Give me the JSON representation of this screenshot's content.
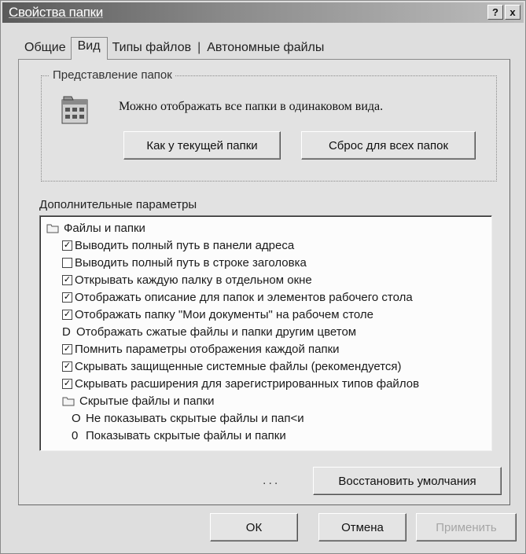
{
  "window": {
    "title": "Свойства папки",
    "help_btn": "?",
    "close_btn": "x"
  },
  "tabs": [
    {
      "label": "Общие",
      "active": false
    },
    {
      "label": "Вид",
      "active": true
    },
    {
      "label": "Типы файлов",
      "active": false
    },
    {
      "label": "Автономные файлы",
      "active": false
    }
  ],
  "view_group": {
    "legend": "Представление папок",
    "description": "Можно отображать все папки в одинаковом вида.",
    "like_current_btn": "Как у текущей папки",
    "reset_all_btn": "Сброс для всех папок"
  },
  "advanced": {
    "label": "Дополнительные параметры",
    "items": [
      {
        "kind": "folder",
        "text": "Файлы и папки",
        "level": 0
      },
      {
        "kind": "checkbox",
        "checked": true,
        "text": "Выводить полный путь в панели адреса",
        "level": 1
      },
      {
        "kind": "checkbox",
        "checked": false,
        "text": "Выводить полный путь в строке заголовка",
        "level": 1
      },
      {
        "kind": "checkbox",
        "checked": true,
        "text": "Открывать каждую палку в отдельном окне",
        "level": 1
      },
      {
        "kind": "checkbox",
        "checked": true,
        "text": "Отображать описание для папок и элементов рабочего стола",
        "level": 1
      },
      {
        "kind": "checkbox",
        "checked": true,
        "text": "Отображать папку \"Мои документы\" на рабочем столе",
        "level": 1
      },
      {
        "kind": "mark",
        "mark": "D",
        "text": "Отображать сжатые файлы и папки другим цветом",
        "level": 1
      },
      {
        "kind": "checkbox",
        "checked": true,
        "text": "Помнить параметры отображения каждой папки",
        "level": 1
      },
      {
        "kind": "checkbox",
        "checked": true,
        "text": "Скрывать защищенные системные файлы (рекомендуется)",
        "level": 1
      },
      {
        "kind": "checkbox",
        "checked": true,
        "text": "Скрывать расширения для зарегистрированных типов файлов",
        "level": 1
      },
      {
        "kind": "folder",
        "text": "Скрытые файлы и папки",
        "level": 1
      },
      {
        "kind": "mark",
        "mark": "O",
        "text": "Не показывать скрытые файлы и пап<и",
        "level": 2
      },
      {
        "kind": "mark",
        "mark": "0",
        "text": "Показывать скрытые файлы и папки",
        "level": 2
      }
    ],
    "ellipsis": "...",
    "restore_btn": "Восстановить умолчания"
  },
  "footer": {
    "ok": "ОК",
    "cancel": "Отмена",
    "apply": "Применить"
  }
}
